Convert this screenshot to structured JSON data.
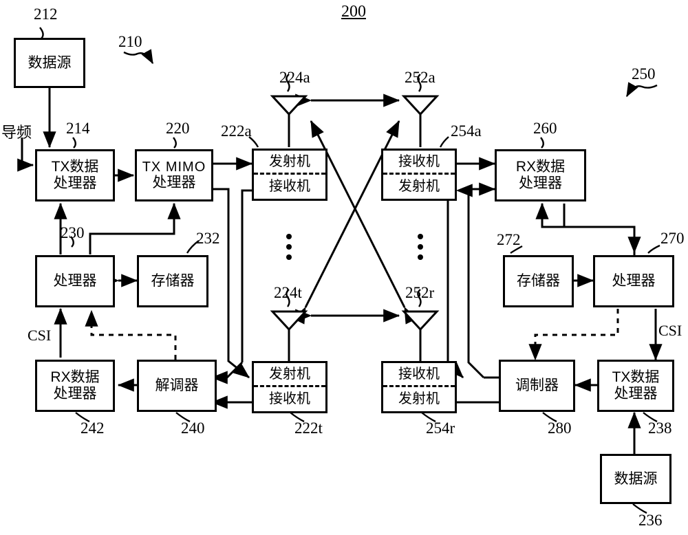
{
  "figure": {
    "title": "200",
    "left_system_ref": "210",
    "right_system_ref": "250"
  },
  "labels": {
    "pilot": "导频",
    "csi_left": "CSI",
    "csi_right": "CSI"
  },
  "blocks": {
    "data_source_left": {
      "text": "数据源",
      "ref": "212"
    },
    "tx_data_processor_left": {
      "line1": "TX数据",
      "line2": "处理器",
      "ref": "214"
    },
    "tx_mimo_processor": {
      "line1": "TX MIMO",
      "line2": "处理器",
      "ref": "220"
    },
    "transceiver_a_left": {
      "top": "发射机",
      "bottom": "接收机",
      "ref": "222a"
    },
    "transceiver_t_left": {
      "top": "发射机",
      "bottom": "接收机",
      "ref": "222t"
    },
    "processor_left": {
      "text": "处理器",
      "ref": "230"
    },
    "memory_left": {
      "text": "存储器",
      "ref": "232"
    },
    "demodulator": {
      "text": "解调器",
      "ref": "240"
    },
    "rx_data_processor_left": {
      "line1": "RX数据",
      "line2": "处理器",
      "ref": "242"
    },
    "transceiver_a_right": {
      "top": "接收机",
      "bottom": "发射机",
      "ref": "254a"
    },
    "transceiver_r_right": {
      "top": "接收机",
      "bottom": "发射机",
      "ref": "254r"
    },
    "rx_data_processor_right": {
      "line1": "RX数据",
      "line2": "处理器",
      "ref": "260"
    },
    "processor_right": {
      "text": "处理器",
      "ref": "270"
    },
    "memory_right": {
      "text": "存储器",
      "ref": "272"
    },
    "modulator": {
      "text": "调制器",
      "ref": "280"
    },
    "tx_data_processor_right": {
      "line1": "TX数据",
      "line2": "处理器",
      "ref": "238"
    },
    "data_source_right": {
      "text": "数据源",
      "ref": "236"
    }
  },
  "antennas": {
    "left_top": "224a",
    "left_bottom": "224t",
    "right_top": "252a",
    "right_bottom": "252r"
  }
}
